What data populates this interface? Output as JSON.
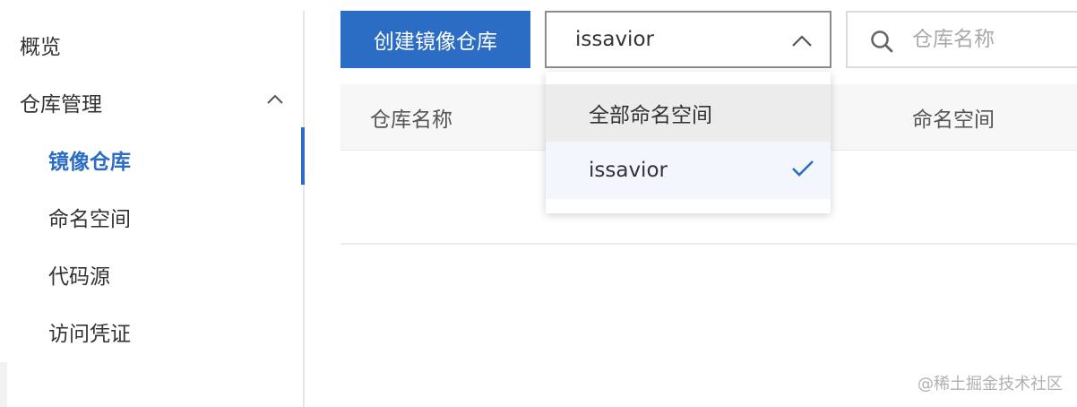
{
  "sidebar": {
    "items": [
      {
        "label": "概览"
      },
      {
        "label": "仓库管理",
        "expanded": true,
        "icon": "chevron-up-icon"
      },
      {
        "label": "镜像仓库",
        "active": true
      },
      {
        "label": "命名空间"
      },
      {
        "label": "代码源"
      },
      {
        "label": "访问凭证"
      }
    ]
  },
  "toolbar": {
    "create_button": "创建镜像仓库",
    "namespace_select": {
      "value": "issavior",
      "icon": "chevron-up-icon"
    },
    "search": {
      "placeholder": "仓库名称",
      "value": "",
      "icon": "search-icon"
    }
  },
  "table": {
    "columns": [
      "仓库名称",
      "命名空间"
    ],
    "rows": []
  },
  "dropdown": {
    "options": [
      {
        "label": "全部命名空间",
        "hovered": true
      },
      {
        "label": "issavior",
        "selected": true,
        "icon": "check-icon"
      }
    ]
  },
  "watermark": "@稀土掘金技术社区",
  "colors": {
    "accent": "#2b6cc4",
    "hover": "#ececec",
    "selected_bg": "#f3f7fd"
  }
}
